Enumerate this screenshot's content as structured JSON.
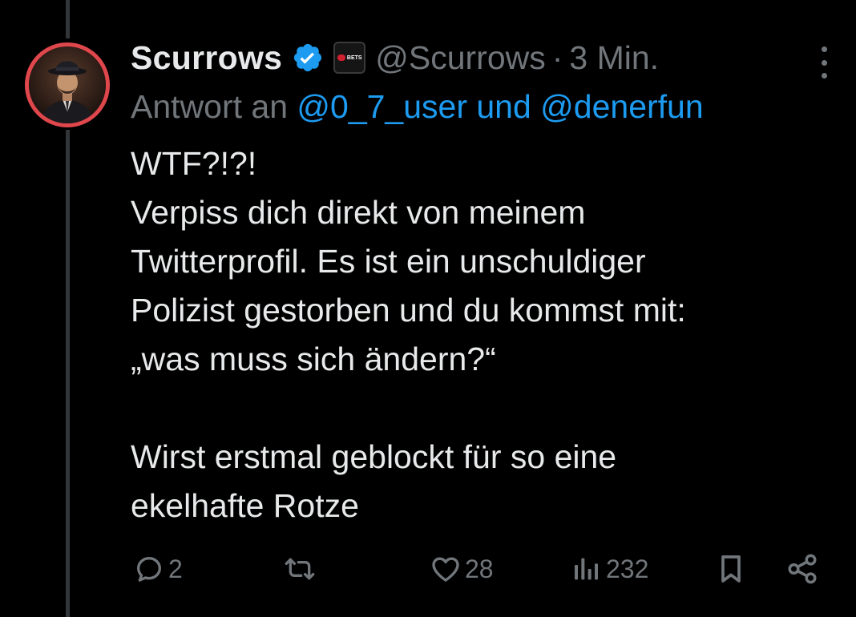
{
  "tweet": {
    "display_name": "Scurrows",
    "handle": "@Scurrows",
    "separator": "·",
    "time": "3 Min.",
    "affiliate_badge_text": "BETS",
    "reply_prefix": "Antwort an ",
    "reply_mentions": "@0_7_user und @denerfun",
    "body_lines": [
      "WTF?!?!",
      "Verpiss dich direkt von meinem",
      "Twitterprofil. Es ist ein unschuldiger",
      "Polizist gestorben und du kommst mit:",
      "„was muss sich ändern?“",
      "",
      "Wirst erstmal geblockt für so eine",
      "ekelhafte Rotze"
    ]
  },
  "actions": {
    "replies": "2",
    "reposts": "",
    "likes": "28",
    "views": "232"
  },
  "icons": {
    "verified": "verified-badge-icon",
    "more": "more-options-icon",
    "reply": "reply-icon",
    "repost": "repost-icon",
    "like": "heart-icon",
    "views": "views-chart-icon",
    "bookmark": "bookmark-icon",
    "share": "share-icon"
  },
  "colors": {
    "background": "#000000",
    "text": "#e7e9ea",
    "muted": "#71767b",
    "accent": "#1d9bf0",
    "avatar_ring": "#e0474c"
  }
}
